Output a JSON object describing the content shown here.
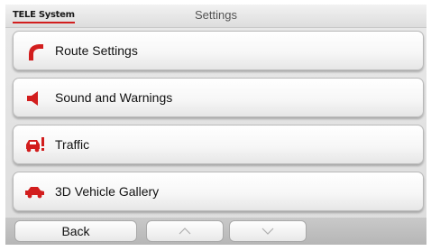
{
  "header": {
    "logo": "TELE System",
    "title": "Settings"
  },
  "menu": {
    "items": [
      {
        "label": "Route Settings",
        "icon": "route-icon"
      },
      {
        "label": "Sound and Warnings",
        "icon": "speaker-icon"
      },
      {
        "label": "Traffic",
        "icon": "traffic-car-icon"
      },
      {
        "label": "3D Vehicle Gallery",
        "icon": "vehicle-icon"
      }
    ]
  },
  "footer": {
    "back_label": "Back",
    "scroll_up_icon": "scroll-up-icon",
    "scroll_down_icon": "scroll-down-icon"
  },
  "colors": {
    "accent": "#d21e1e",
    "background": "#e2e2e2",
    "button": "#f4f4f4"
  }
}
